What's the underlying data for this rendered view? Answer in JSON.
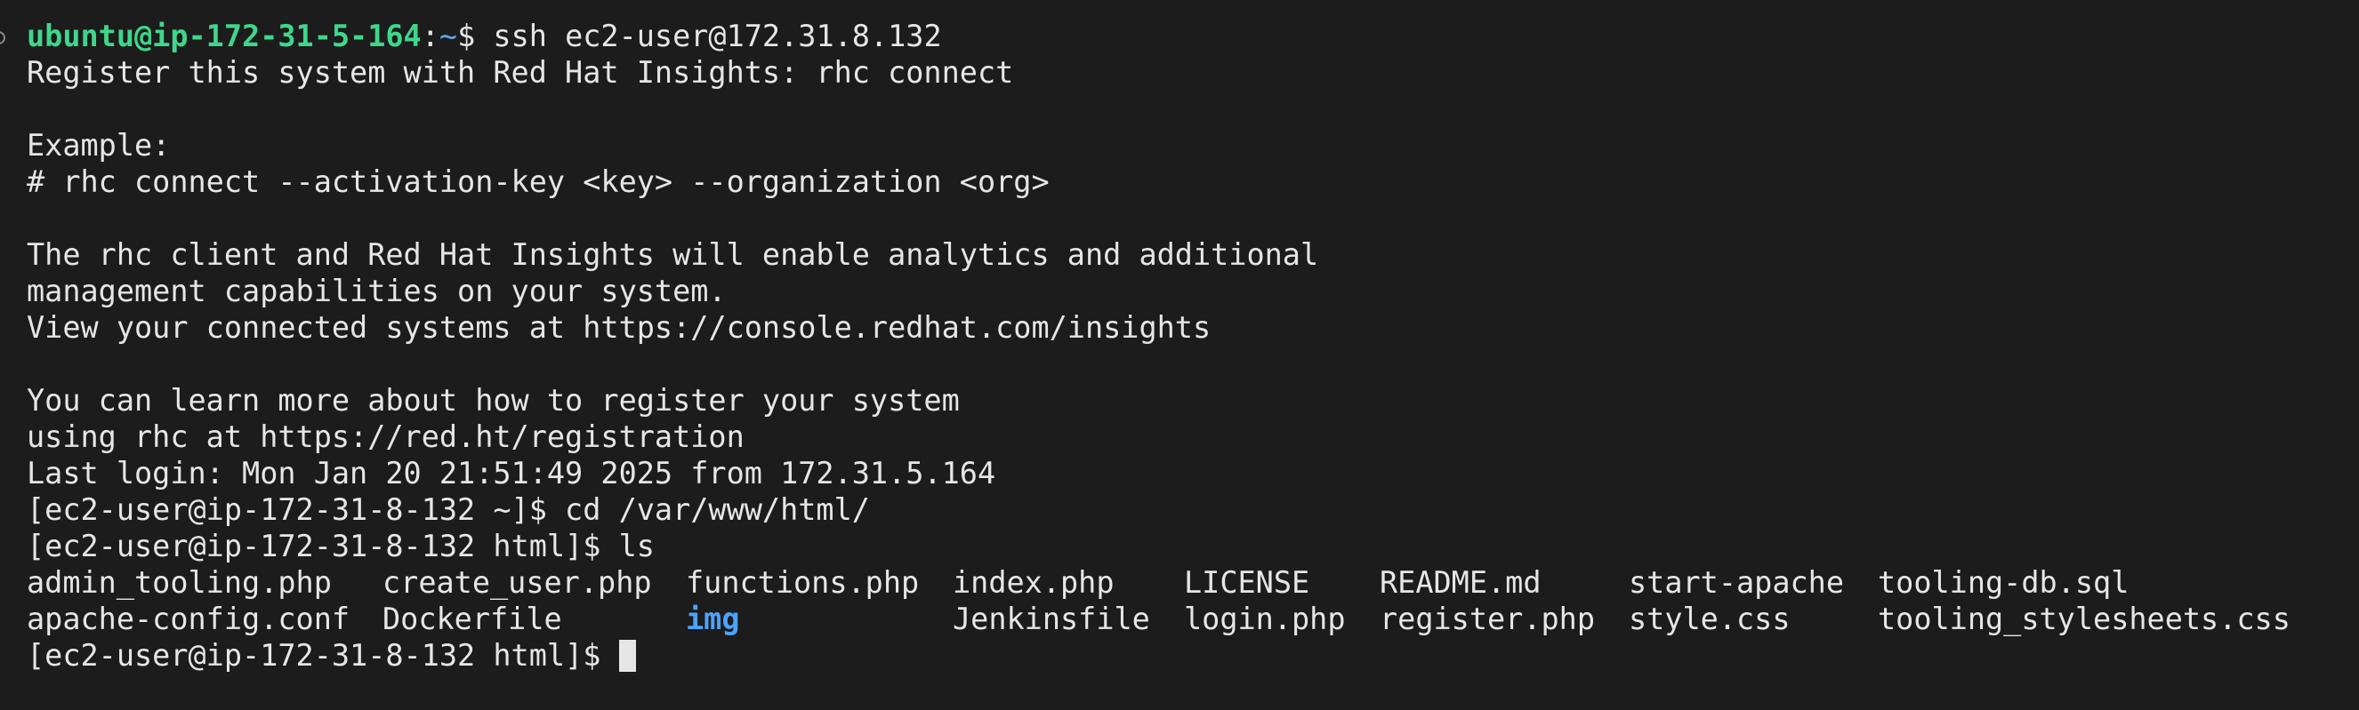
{
  "prompt_user_host": "ubuntu@ip-172-31-5-164",
  "prompt_colon": ":",
  "prompt_path": "~",
  "prompt_dollar": "$ ",
  "ssh_command": "ssh ec2-user@172.31.8.132",
  "motd": [
    "Register this system with Red Hat Insights: rhc connect",
    "",
    "Example:",
    "# rhc connect --activation-key <key> --organization <org>",
    "",
    "The rhc client and Red Hat Insights will enable analytics and additional",
    "management capabilities on your system.",
    "View your connected systems at https://console.redhat.com/insights",
    "",
    "You can learn more about how to register your system",
    "using rhc at https://red.ht/registration"
  ],
  "last_login": "Last login: Mon Jan 20 21:51:49 2025 from 172.31.5.164",
  "cmd_cd": "[ec2-user@ip-172-31-8-132 ~]$ cd /var/www/html/",
  "cmd_ls": "[ec2-user@ip-172-31-8-132 html]$ ls",
  "ls_row1": [
    "admin_tooling.php",
    "create_user.php",
    "functions.php",
    "index.php",
    "LICENSE",
    "README.md",
    "start-apache",
    "tooling-db.sql"
  ],
  "ls_row2": [
    "apache-config.conf",
    "Dockerfile",
    "img",
    "Jenkinsfile",
    "login.php",
    "register.php",
    "style.css",
    "tooling_stylesheets.css"
  ],
  "final_prompt": "[ec2-user@ip-172-31-8-132 html]$ ",
  "colors": {
    "background": "#1c1c1c",
    "text": "#e6e6e6",
    "prompt_user": "#3fd68c",
    "prompt_path": "#5aa9f2",
    "directory": "#4aa3ff"
  }
}
